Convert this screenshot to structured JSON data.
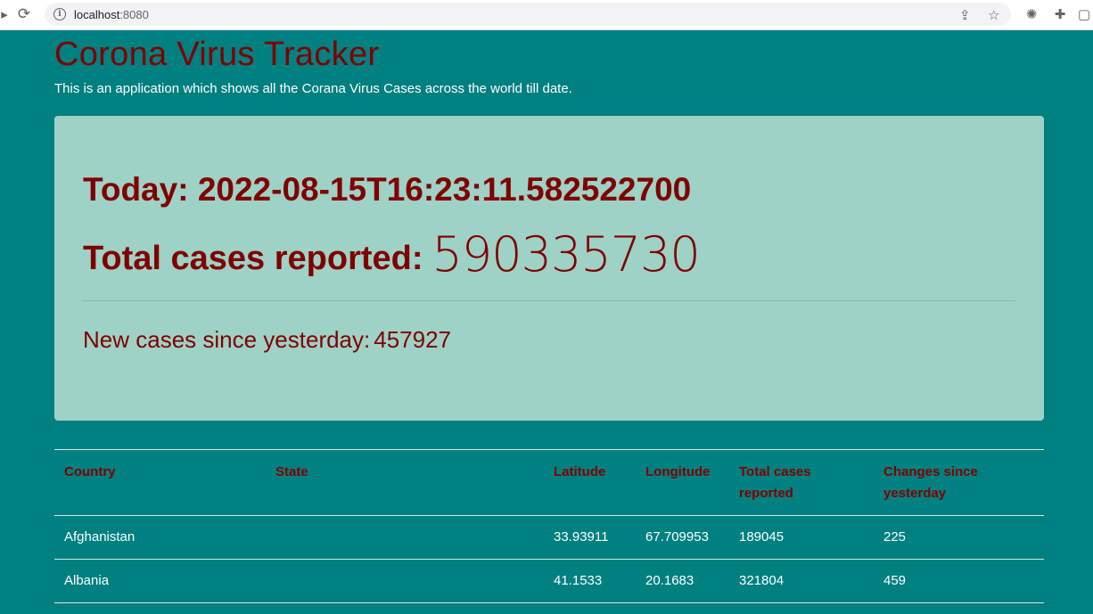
{
  "browser": {
    "url_host": "localhost",
    "url_port": ":8080"
  },
  "page": {
    "title": "Corona Virus Tracker",
    "subtitle": "This is an application which shows all the Corana Virus Cases across the world till date."
  },
  "summary": {
    "today_label": "Today:",
    "today_value": "2022-08-15T16:23:11.582522700",
    "total_label": "Total cases reported:",
    "total_value": "590335730",
    "new_label": "New cases since yesterday:",
    "new_value": "457927"
  },
  "table": {
    "headers": [
      "Country",
      "State",
      "Latitude",
      "Longitude",
      "Total cases reported",
      "Changes since yesterday"
    ],
    "rows": [
      [
        "Afghanistan",
        "",
        "33.93911",
        "67.709953",
        "189045",
        "225"
      ],
      [
        "Albania",
        "",
        "41.1533",
        "20.1683",
        "321804",
        "459"
      ]
    ]
  }
}
